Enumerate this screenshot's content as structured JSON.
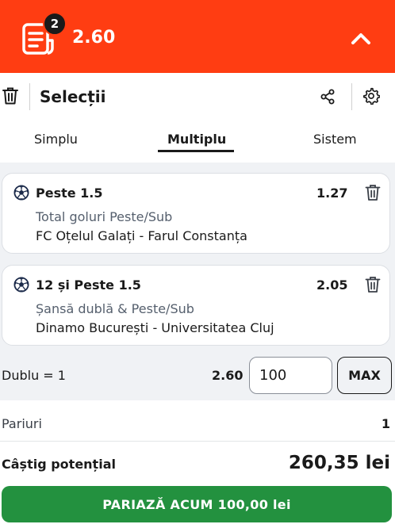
{
  "header": {
    "selection_count": "2",
    "total_odds": "2.60",
    "colors": {
      "background": "#ff3d12",
      "text": "#ffffff"
    }
  },
  "toolbar": {
    "title": "Selecții"
  },
  "tabs": [
    {
      "label": "Simplu",
      "active": false
    },
    {
      "label": "Multiplu",
      "active": true
    },
    {
      "label": "Sistem",
      "active": false
    }
  ],
  "selections": [
    {
      "pick": "Peste 1.5",
      "odds": "1.27",
      "market": "Total goluri Peste/Sub",
      "event": "FC Oțelul Galați - Farul Constanța",
      "icon": "soccer-ball-icon"
    },
    {
      "pick": "12 și Peste 1.5",
      "odds": "2.05",
      "market": "Șansă dublă & Peste/Sub",
      "event": "Dinamo București - Universitatea Cluj",
      "icon": "soccer-ball-icon"
    }
  ],
  "stake": {
    "label": "Dublu = 1",
    "odds": "2.60",
    "value": "100",
    "max_label": "MAX"
  },
  "summary": {
    "bets_label": "Pariuri",
    "bets_value": "1",
    "win_label": "Câștig potențial",
    "win_value": "260,35 lei"
  },
  "place_bet": {
    "label": "PARIAZĂ ACUM 100,00 lei",
    "color": "#23913f"
  }
}
